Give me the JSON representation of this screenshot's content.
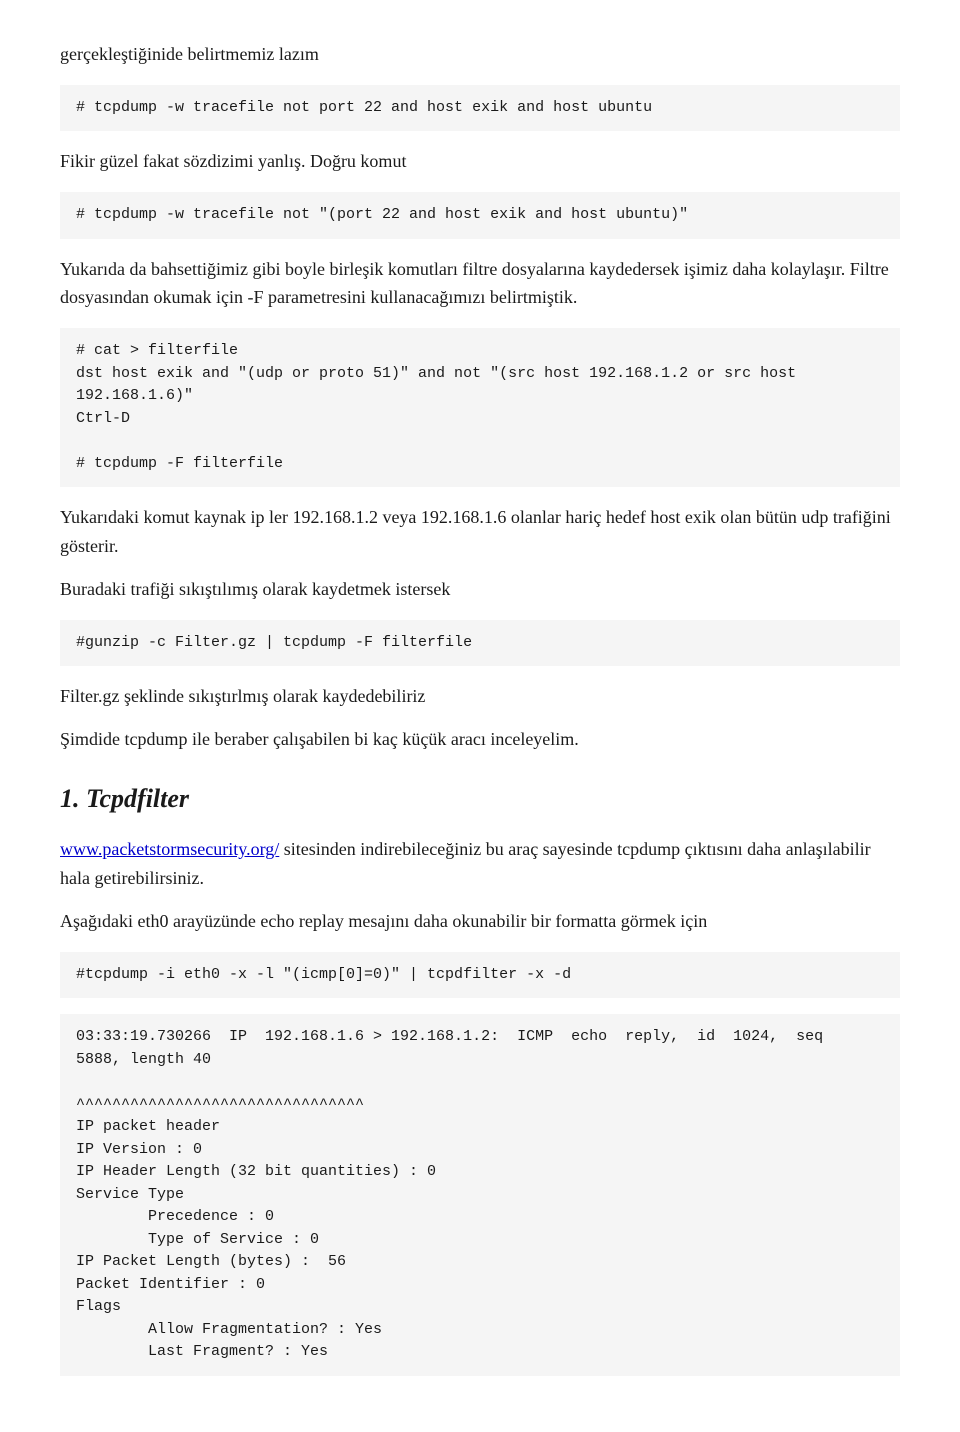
{
  "content": {
    "intro_para": "gerçekleştiğinide belirtmemiz lazım",
    "cmd1_label": "# tcpdump -w tracefile not port 22 and host exik and host ubuntu",
    "wrong_note": "Fikir güzel fakat sözdizimi yanlış. Doğru komut",
    "code_block1": "# tcpdump -w tracefile not \"(port 22 and host exik and host ubuntu)\"",
    "explanation1": "Yukarıda da bahsettiğimiz gibi boyle birleşik komutları filtre dosyalarına kaydedersek işimiz daha kolaylaşır. Filtre dosyasından okumak için -F parametresini kullanacağımızı belirtmiştik.",
    "code_block2": "# cat > filterfile\ndst host exik and \"(udp or proto 51)\" and not \"(src host 192.168.1.2 or src host\n192.168.1.6)\"\nCtrl-D\n\n# tcpdump -F filterfile",
    "explanation2": "Yukarıdaki komut kaynak ip ler 192.168.1.2 veya 192.168.1.6  olanlar hariç hedef host exik olan bütün udp trafiğini gösterir.",
    "explanation3": "Buradaki trafiği sıkıştılımış olarak kaydetmek istersek",
    "code_block3": "#gunzip -c Filter.gz | tcpdump -F filterfile",
    "explanation4": "Filter.gz şeklinde sıkıştırlmış olarak kaydedebiliriz",
    "explanation5": "Şimdide tcpdump ile beraber çalışabilen bi kaç küçük aracı inceleyelim.",
    "section1_title": "1. Tcpdfilter",
    "link_text": "www.packetstormsecurity.org/",
    "link_href": "http://www.packetstormsecurity.org/",
    "explanation6": " sitesinden indirebileceğiniz bu araç sayesinde tcpdump çıktısını daha anlaşılabilir hala getirebilirsiniz.",
    "explanation7": "Aşağıdaki  eth0 arayüzünde echo replay mesajını daha okunabilir bir formatta görmek için",
    "code_block4": "#tcpdump -i eth0 -x -l \"(icmp[0]=0)\" | tcpdfilter -x -d",
    "code_block5": "03:33:19.730266  IP  192.168.1.6 > 192.168.1.2:  ICMP  echo  reply,  id  1024,  seq\n5888, length 40\n\n^^^^^^^^^^^^^^^^^^^^^^^^^^^^^^^^\nIP packet header\nIP Version : 0\nIP Header Length (32 bit quantities) : 0\nService Type\n        Precedence : 0\n        Type of Service : 0\nIP Packet Length (bytes) :  56\nPacket Identifier : 0\nFlags\n        Allow Fragmentation? : Yes\n        Last Fragment? : Yes"
  }
}
